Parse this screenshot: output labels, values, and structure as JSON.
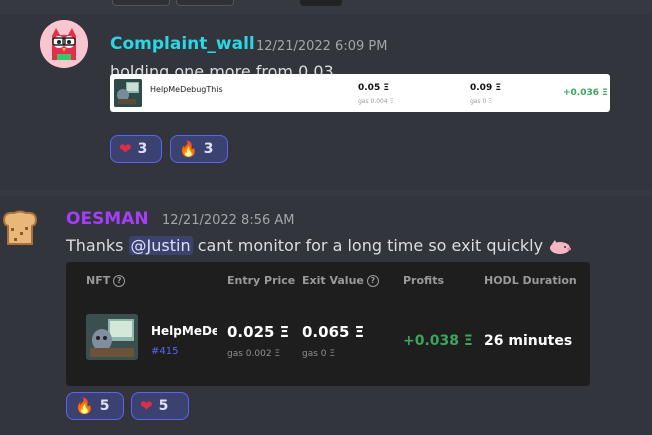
{
  "messages": [
    {
      "author": "Complaint_wall",
      "author_color": "#2bd7e6",
      "timestamp": "12/21/2022 6:09 PM",
      "text": "holding one more from 0.03",
      "card": {
        "name": "HelpMeDebugThis",
        "entry": "0.05 Ξ",
        "entry_gas": "gas 0.004 Ξ",
        "exit": "0.09 Ξ",
        "exit_gas": "gas 0 Ξ",
        "profit": "+0.036 Ξ"
      },
      "reactions": [
        {
          "emoji": "❤",
          "emoji_name": "heart-icon",
          "count": "3"
        },
        {
          "emoji": "🔥",
          "emoji_name": "fire-icon",
          "count": "3"
        }
      ]
    },
    {
      "author": "OESMAN",
      "author_color": "#a53ff5",
      "timestamp": "12/21/2022 8:56 AM",
      "text_before": "Thanks ",
      "mention": "@Justin",
      "text_after": " cant monitor for a long time so exit quickly",
      "card": {
        "headers": {
          "nft": "NFT",
          "entry_price": "Entry Price",
          "exit_value": "Exit Value",
          "profits": "Profits",
          "hodl": "HODL Duration"
        },
        "name": "HelpMeDebugThis",
        "token": "#415",
        "entry": "0.025 Ξ",
        "entry_gas": "gas 0.002 Ξ",
        "exit": "0.065 Ξ",
        "exit_gas": "gas 0 Ξ",
        "profit": "+0.038 Ξ",
        "duration": "26 minutes"
      },
      "reactions": [
        {
          "emoji": "🔥",
          "emoji_name": "fire-icon",
          "count": "5"
        },
        {
          "emoji": "❤",
          "emoji_name": "heart-icon",
          "count": "5"
        }
      ]
    }
  ],
  "colors": {
    "background": "#36393f",
    "reaction_bg": "#3c4270",
    "reaction_border": "#5865f2",
    "profit_green": "#3ba55d"
  }
}
